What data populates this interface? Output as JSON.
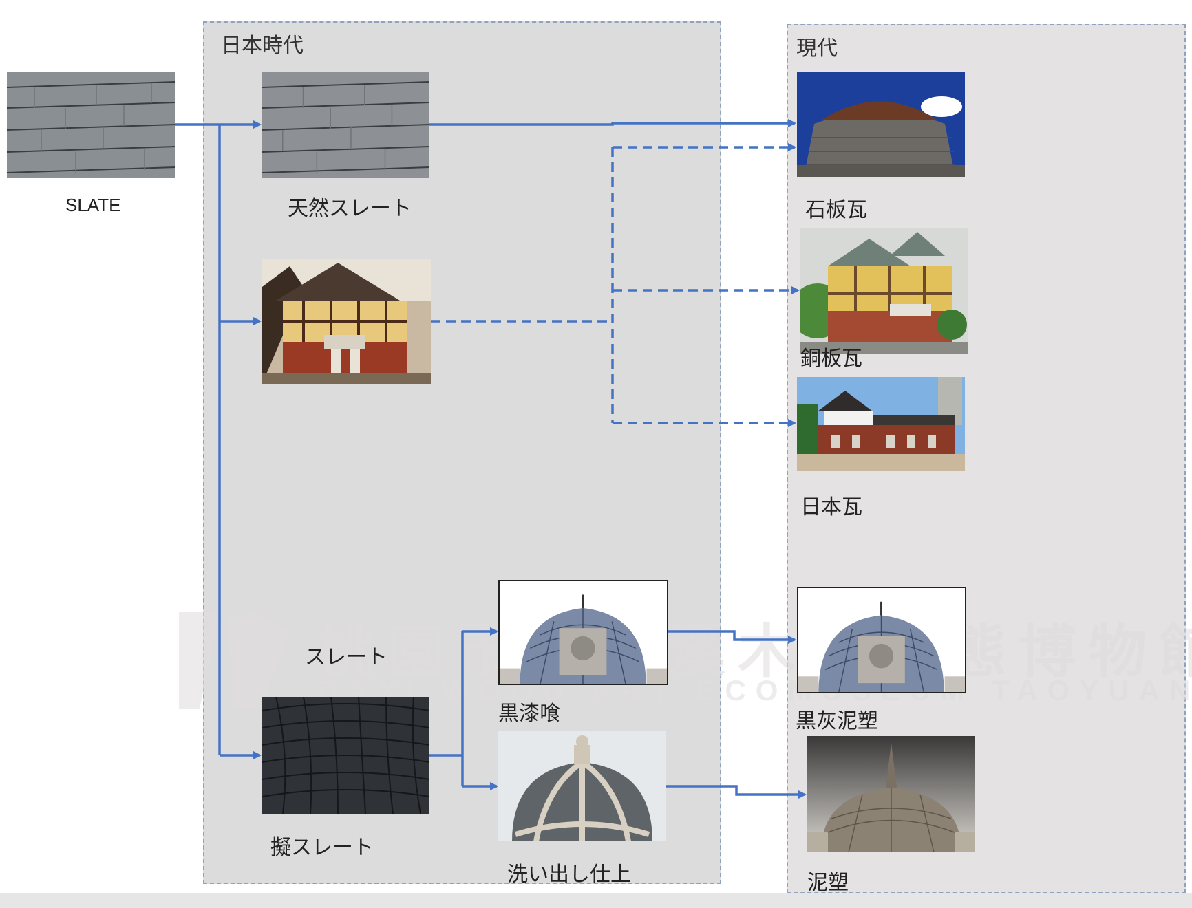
{
  "panels": {
    "japan_era": "日本時代",
    "modern": "現代"
  },
  "labels": {
    "slate": "SLATE",
    "natural_slate": "天然スレート",
    "slate_dome": "スレート",
    "imitation_slate": "擬スレート",
    "black_plaster": "黒漆喰",
    "washed_finish": "洗い出し仕上",
    "stone_tile": "石板瓦",
    "copper_tile": "銅板瓦",
    "japanese_tile": "日本瓦",
    "black_ash_relief": "黒灰泥塑",
    "plaster_relief": "泥塑"
  },
  "watermark": {
    "chinese": "桃園市立大溪木藝生態博物館",
    "english": "DAXI WOOD ART ECOMUSEUM TAOYUAN"
  },
  "colors": {
    "arrow": "#4472c4",
    "panel_border": "#8fa3bf"
  }
}
